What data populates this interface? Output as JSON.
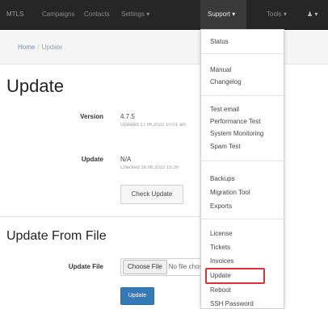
{
  "navbar": {
    "brand": "MTLS",
    "items": [
      "Campaigns",
      "Contacts",
      "Settings ▾"
    ],
    "support": "Support ▾",
    "user": "Tools ▾",
    "account": "♟ ▾"
  },
  "breadcrumb": {
    "home": "Home",
    "separator": "/",
    "current": "Update"
  },
  "page": {
    "title": "Update",
    "version_label": "Version",
    "version_value": "4.7.5",
    "version_sub": "Updated 17.06.2022 10:01 am",
    "update_label": "Update",
    "update_value": "N/A",
    "update_sub": "Checked 16.06.2022 15:30",
    "check_button": "Check Update",
    "section_title": "Update From File",
    "file_label": "Update File",
    "file_choose": "Choose File",
    "file_status": "No file chosen",
    "submit_button": "Update"
  },
  "dropdown": {
    "groups": [
      [
        "Status"
      ],
      [
        "Manual",
        "Changelog"
      ],
      [
        "Test email",
        "Performance Test",
        "System Monitoring",
        "Spam Test"
      ],
      [
        "Backups",
        "Migration Tool",
        "Exports"
      ],
      [
        "License",
        "Tickets",
        "Invoices",
        "Update",
        "Reboot",
        "SSH Password"
      ]
    ],
    "highlighted": "Update"
  },
  "colors": {
    "navbar_bg": "#262626",
    "primary": "#337ab7",
    "highlight_border": "#d9343c"
  }
}
